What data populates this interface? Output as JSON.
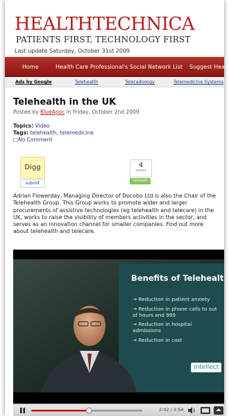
{
  "site": {
    "logo": "HEALTHTECHNICA",
    "tagline": "PATIENTS FIRST, TECHNOLOGY FIRST",
    "last_update": "Last update Saturday, October 31st 2009"
  },
  "nav": {
    "items": [
      "Home",
      "Health Care Professional's Social Network List",
      "Suggest Hea"
    ]
  },
  "ads": {
    "label": "Ads by Google",
    "links": [
      "Telehealth",
      "Teleradiology",
      "Telemedicine Systems"
    ]
  },
  "post": {
    "title": "Telehealth in the UK",
    "posted_prefix": "Posted by ",
    "author": "BlueApoc",
    "posted_suffix": " in Friday, October 2nd 2009",
    "topics_label": "Topics:",
    "topics_value": "Video",
    "tags_label": "Tags:",
    "tags": [
      "telehealth",
      "telemedicine"
    ],
    "comments": "No Comment",
    "body": "Adrian Flowerday, Managing Director of Docobo Ltd is also the Chair of the Telehealth Group. This Group works to promote wider and larger procurements of assistive technologies (eg telehealth and telecare) in the UK, works to raise the visibility of members activities in the sector, and serves as an innovation channel for smaller companies. Find out more about telehealth and telecare."
  },
  "social": {
    "digg_label": "Digg",
    "digg_submit": "submit",
    "tweet_count": "4",
    "tweet_label": "tweets",
    "retweet_label": "retweet"
  },
  "video": {
    "slide_title": "Benefits of Telehealth",
    "bullets": [
      "Reduction in patient anxiety",
      "Reduction in phone calls to out of hours and 999",
      "Reduction in hospital admissions",
      "Reduction in cost"
    ],
    "brand": "intellect",
    "time": "2:02 / 3:54",
    "progress": 0.52,
    "colors": {
      "progress": "#cc1111",
      "slide_bg": "#1d4b4e",
      "accent": "#b0201c"
    }
  }
}
